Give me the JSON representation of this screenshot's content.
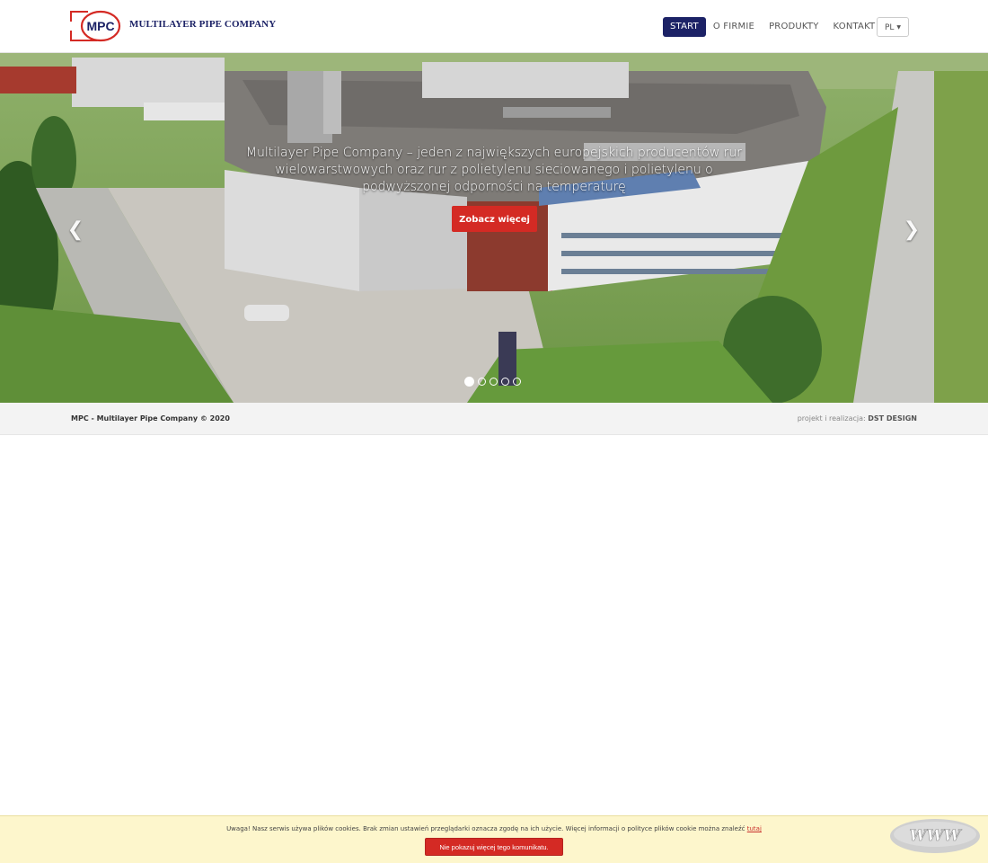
{
  "brand": {
    "logo_text": "MPC",
    "name": "MULTILAYER PIPE COMPANY"
  },
  "nav": {
    "items": [
      {
        "label": "START",
        "active": true
      },
      {
        "label": "O FIRMIE",
        "active": false
      },
      {
        "label": "PRODUKTY",
        "active": false
      },
      {
        "label": "KONTAKT",
        "active": false
      }
    ],
    "language": "PL"
  },
  "hero": {
    "caption": "Multilayer Pipe Company – jeden z największych europejskich producentów rur wielowarstwowych oraz rur z polietylenu sieciowanego i polietylenu o podwyższonej odporności na temperaturę",
    "cta_label": "Zobacz więcej",
    "prev_icon": "chevron-left-icon",
    "next_icon": "chevron-right-icon",
    "slides_count": 5,
    "active_slide": 1
  },
  "footer": {
    "copyright": "MPC - Multilayer Pipe Company © 2020",
    "credits_prefix": "projekt i realizacja:",
    "credits_name": "DST DESIGN"
  },
  "cookie": {
    "message": "Uwaga! Nasz serwis używa plików cookies. Brak zmian ustawień przeglądarki oznacza zgodę na ich użycie. Więcej informacji o polityce plików cookie można znaleźć",
    "link_text": "tutaj",
    "button_label": "Nie pokazuj więcej tego komunikatu."
  },
  "badge": {
    "text": "WWW"
  },
  "colors": {
    "brand_navy": "#1c2266",
    "accent_red": "#d42a24",
    "cookie_bg": "#fdf6cc"
  }
}
